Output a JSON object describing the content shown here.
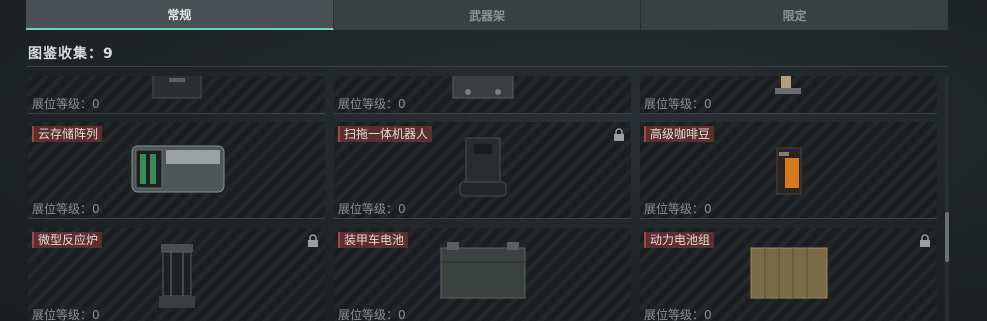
{
  "tabs": [
    {
      "label": "常规",
      "active": true
    },
    {
      "label": "武器架",
      "active": false
    },
    {
      "label": "限定",
      "active": false
    }
  ],
  "collection": {
    "text": "图鉴收集：9"
  },
  "level_text": "展位等级：0",
  "items": [
    {
      "name": "",
      "icon": "case-icon",
      "locked": false
    },
    {
      "name": "",
      "icon": "device-icon",
      "locked": false
    },
    {
      "name": "",
      "icon": "gadget-icon",
      "locked": false
    },
    {
      "name": "云存储阵列",
      "icon": "storage-array-icon",
      "locked": false
    },
    {
      "name": "扫拖一体机器人",
      "icon": "robot-vacuum-icon",
      "locked": true
    },
    {
      "name": "高级咖啡豆",
      "icon": "coffee-bag-icon",
      "locked": false
    },
    {
      "name": "微型反应炉",
      "icon": "reactor-icon",
      "locked": true
    },
    {
      "name": "装甲车电池",
      "icon": "car-battery-icon",
      "locked": false
    },
    {
      "name": "动力电池组",
      "icon": "battery-pack-icon",
      "locked": true
    }
  ]
}
